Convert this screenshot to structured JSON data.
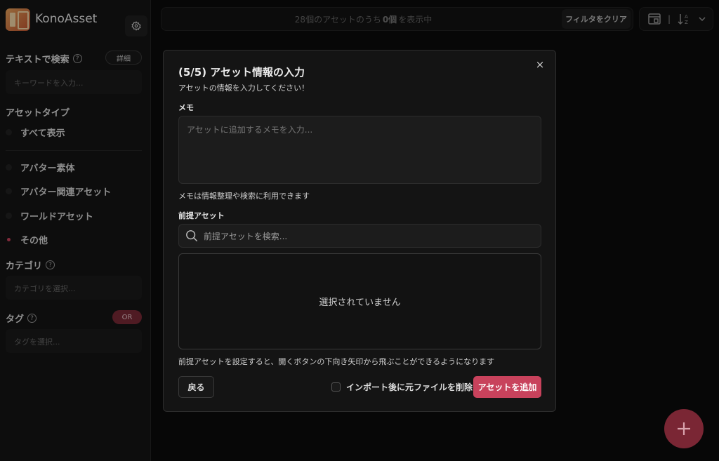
{
  "app": {
    "name": "KonoAsset"
  },
  "sidebar": {
    "text_search": {
      "title": "テキストで検索",
      "detail_label": "詳細",
      "placeholder": "キーワードを入力..."
    },
    "asset_type": {
      "title": "アセットタイプ",
      "options": [
        {
          "label": "すべて表示",
          "selected": false
        },
        {
          "label": "アバター素体",
          "selected": false
        },
        {
          "label": "アバター関連アセット",
          "selected": false
        },
        {
          "label": "ワールドアセット",
          "selected": false
        },
        {
          "label": "その他",
          "selected": true
        }
      ]
    },
    "category": {
      "title": "カテゴリ",
      "placeholder": "カテゴリを選択..."
    },
    "tag": {
      "title": "タグ",
      "mode_label": "OR",
      "placeholder": "タグを選択..."
    },
    "help_symbol": "?"
  },
  "topbar": {
    "status_prefix": "28個のアセットのうち",
    "status_count": "0個",
    "status_suffix": "を表示中",
    "clear_filter_label": "フィルタをクリア",
    "separator": "|"
  },
  "modal": {
    "title": "(5/5) アセット情報の入力",
    "subtitle": "アセットの情報を入力してください！",
    "memo_label": "メモ",
    "memo_placeholder": "アセットに追加するメモを入力...",
    "memo_hint": "メモは情報整理や検索に利用できます",
    "prereq_label": "前提アセット",
    "prereq_search_placeholder": "前提アセットを検索...",
    "prereq_empty": "選択されていません",
    "prereq_hint": "前提アセットを設定すると、開くボタンの下向き矢印から飛ぶことができるようになります",
    "back_label": "戻る",
    "delete_checkbox_label": "インポート後に元ファイルを削除する",
    "delete_checked": false,
    "add_label": "アセットを追加",
    "close_symbol": "×"
  },
  "fab": {
    "icon": "plus-icon"
  },
  "colors": {
    "accent": "#c8425c",
    "background": "#0b0b0b",
    "panel": "#141414"
  }
}
